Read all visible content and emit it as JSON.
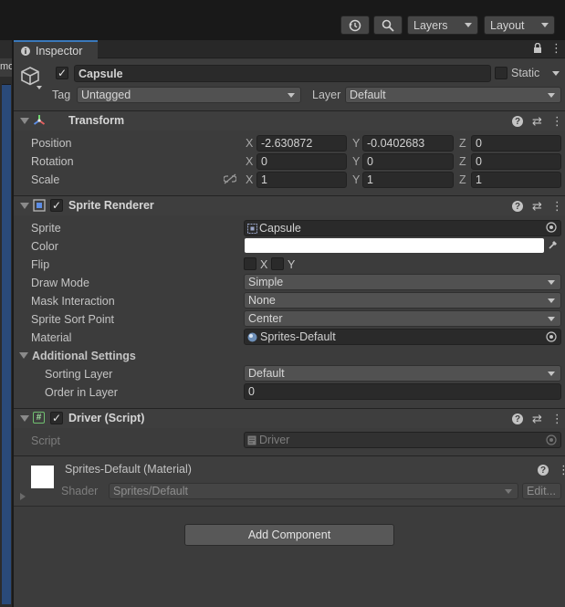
{
  "toolbar": {
    "history_icon": "history-icon",
    "search_icon": "search-icon",
    "layers_label": "Layers",
    "layout_label": "Layout"
  },
  "left_panel": {
    "tab_fragment": "mo"
  },
  "inspector": {
    "tab_label": "Inspector"
  },
  "object": {
    "active": true,
    "name": "Capsule",
    "static_label": "Static",
    "tag_label": "Tag",
    "tag_value": "Untagged",
    "layer_label": "Layer",
    "layer_value": "Default"
  },
  "transform": {
    "title": "Transform",
    "position_label": "Position",
    "rotation_label": "Rotation",
    "scale_label": "Scale",
    "axis_x": "X",
    "axis_y": "Y",
    "axis_z": "Z",
    "position": {
      "x": "-2.630872",
      "y": "-0.0402683",
      "z": "0"
    },
    "rotation": {
      "x": "0",
      "y": "0",
      "z": "0"
    },
    "scale": {
      "x": "1",
      "y": "1",
      "z": "1"
    }
  },
  "sprite_renderer": {
    "title": "Sprite Renderer",
    "sprite_label": "Sprite",
    "sprite_value": "Capsule",
    "color_label": "Color",
    "color_value": "#ffffff",
    "flip_label": "Flip",
    "flip_x": "X",
    "flip_y": "Y",
    "draw_mode_label": "Draw Mode",
    "draw_mode_value": "Simple",
    "mask_label": "Mask Interaction",
    "mask_value": "None",
    "sort_point_label": "Sprite Sort Point",
    "sort_point_value": "Center",
    "material_label": "Material",
    "material_value": "Sprites-Default",
    "additional_label": "Additional Settings",
    "sorting_layer_label": "Sorting Layer",
    "sorting_layer_value": "Default",
    "order_label": "Order in Layer",
    "order_value": "0"
  },
  "driver": {
    "title": "Driver (Script)",
    "script_label": "Script",
    "script_value": "Driver"
  },
  "material": {
    "title": "Sprites-Default (Material)",
    "shader_label": "Shader",
    "shader_value": "Sprites/Default",
    "edit_label": "Edit..."
  },
  "add_component_label": "Add Component",
  "colors": {
    "accent": "#3a79bb",
    "panel_bg": "#3c3c3c",
    "field_bg": "#2a2a2a"
  }
}
